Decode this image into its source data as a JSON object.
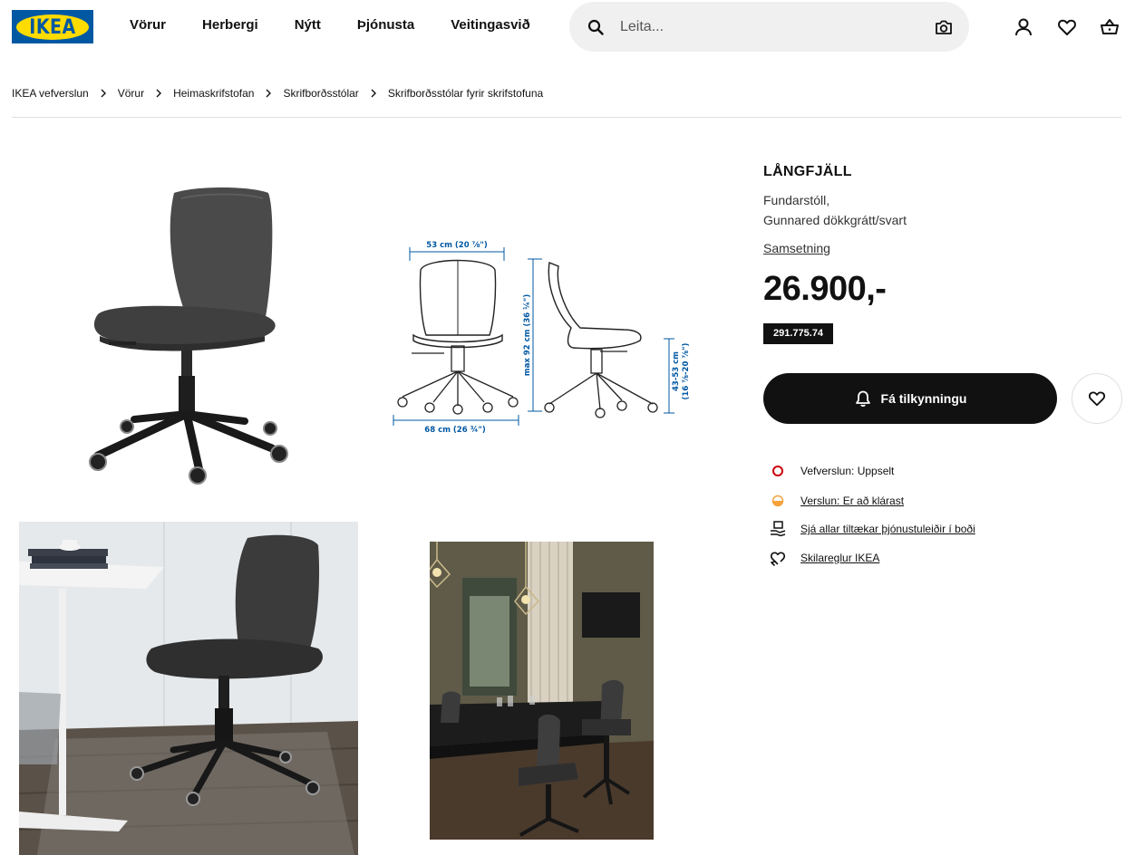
{
  "header": {
    "logo_text": "IKEA",
    "nav": [
      "Vörur",
      "Herbergi",
      "Nýtt",
      "Þjónusta",
      "Veitingasvið"
    ],
    "search_placeholder": "Leita...",
    "icons": [
      "user-icon",
      "heart-icon",
      "basket-icon"
    ]
  },
  "breadcrumb": [
    "IKEA vefverslun",
    "Vörur",
    "Heimaskrifstofan",
    "Skrifborðsstólar",
    "Skrifborðsstólar fyrir skrifstofuna"
  ],
  "gallery": {
    "dimensions": {
      "width_top": "53 cm (20 ⅞\")",
      "width_base": "68 cm (26 ¾\")",
      "max_height": "max 92 cm (36 ¼\")",
      "seat_height": "43-53 cm",
      "seat_height_in": "(16 ⅞-20 ⅞\")"
    }
  },
  "product": {
    "name": "LÅNGFJÄLL",
    "type": "Fundarstóll,",
    "variant": "Gunnared dökkgrátt/svart",
    "link": "Samsetning",
    "price": "26.900,-",
    "article_number": "291.775.74",
    "notify_label": "Fá tilkynningu",
    "info": [
      {
        "icon": "circle-red-icon",
        "text": "Vefverslun: Uppselt",
        "link": false
      },
      {
        "icon": "half-circle-orange-icon",
        "text": "Verslun: Er að klárast",
        "link": true
      },
      {
        "icon": "service-icon",
        "text": "Sjá allar tiltækar þjónustuleiðir í boði",
        "link": true
      },
      {
        "icon": "return-icon",
        "text": "Skilareglur IKEA",
        "link": true
      }
    ]
  },
  "colors": {
    "ikea_blue": "#0058a3",
    "ikea_yellow": "#ffdb00",
    "stock_red": "#cc0008",
    "stock_orange": "#f4a23c"
  }
}
